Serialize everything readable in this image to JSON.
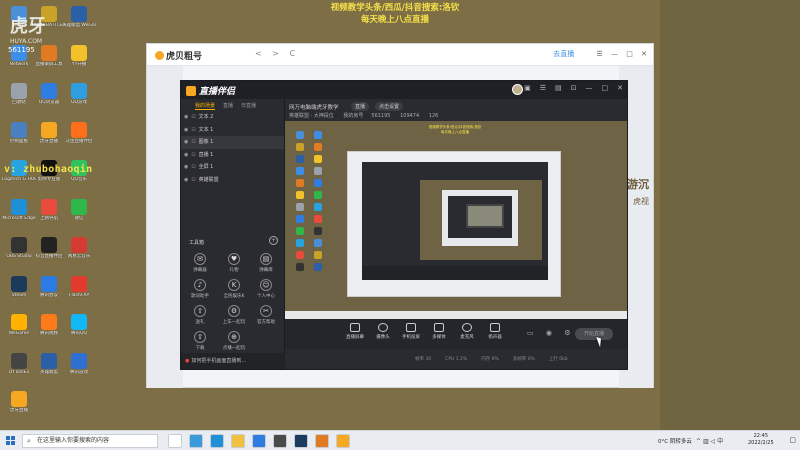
{
  "overlay": {
    "title_line1": "视频教学头条/西瓜/抖音搜索:洛钦",
    "title_line2": "每天晚上八点直播",
    "watermark_logo": "虎牙",
    "watermark_logo_sub": "HUYA.COM",
    "watermark_num": "561195",
    "wechat": "v: zhubohaoqin"
  },
  "desktop_icons": [
    {
      "label": "此电脑",
      "color": "#4a90d9"
    },
    {
      "label": "PUBG BATTLEGR...",
      "color": "#c9a227"
    },
    {
      "label": "英雄联盟 WeGame版",
      "color": "#2b5fa8"
    },
    {
      "label": "Network",
      "color": "#3c8ee6"
    },
    {
      "label": "直播录屏工具",
      "color": "#e07b24"
    },
    {
      "label": "YY开播",
      "color": "#f2c22a"
    },
    {
      "label": "回收站",
      "color": "#9aa3ad"
    },
    {
      "label": "QQ浏览器",
      "color": "#2f7de1"
    },
    {
      "label": "QQ游戏",
      "color": "#2f9ee1"
    },
    {
      "label": "控制面板",
      "color": "#4a7fc1"
    },
    {
      "label": "虎牙直播",
      "color": "#f7a823"
    },
    {
      "label": "斗鱼直播伴侣",
      "color": "#ff6e1a"
    },
    {
      "label": "Logitech G HUB",
      "color": "#27a3e0"
    },
    {
      "label": "剪映专业版",
      "color": "#111111"
    },
    {
      "label": "QQ音乐",
      "color": "#30c25e"
    },
    {
      "label": "Microsoft Edge",
      "color": "#1f8fd6"
    },
    {
      "label": "上网导航",
      "color": "#e84a3b"
    },
    {
      "label": "微信",
      "color": "#2fb84a"
    },
    {
      "label": "OBS Studio",
      "color": "#333333"
    },
    {
      "label": "抖音直播伴侣",
      "color": "#222222"
    },
    {
      "label": "网易云音乐",
      "color": "#d43c33"
    },
    {
      "label": "Steam",
      "color": "#1b3a5c"
    },
    {
      "label": "腾讯会议",
      "color": "#2c7be5"
    },
    {
      "label": "FlashFXP",
      "color": "#e23b2e"
    },
    {
      "label": "WeGame",
      "color": "#ffb300"
    },
    {
      "label": "腾讯视频",
      "color": "#ff7a1a"
    },
    {
      "label": "腾讯QQ",
      "color": "#12b7f5"
    },
    {
      "label": "DYToolEx",
      "color": "#444444"
    },
    {
      "label": "英雄联盟",
      "color": "#2b5fa8"
    },
    {
      "label": "腾讯游戏",
      "color": "#2f6fd1"
    },
    {
      "label": "虎牙直播",
      "color": "#f7a823"
    }
  ],
  "browser": {
    "logo": "虎贝粗号",
    "nav_back": "<",
    "nav_forward": ">",
    "nav_refresh": "C",
    "link_text": "去直播",
    "right_side_big": "游沉",
    "right_side_small": "虎视"
  },
  "app": {
    "logo": "直播伴侣",
    "win_buttons": [
      "▣",
      "☰",
      "▤",
      "⊡",
      "—",
      "□",
      "✕"
    ],
    "side_tabs": [
      "我的场景",
      "直播",
      "日直播"
    ],
    "scenes": [
      {
        "label": "文本 2",
        "selected": false
      },
      {
        "label": "文本 1",
        "selected": false
      },
      {
        "label": "图像 1",
        "selected": true
      },
      {
        "label": "直播 1",
        "selected": false
      },
      {
        "label": "全屏 1",
        "selected": false
      },
      {
        "label": "英雄联盟",
        "selected": false
      }
    ],
    "tools_label": "工具箱",
    "tools": [
      {
        "label": "弹幕器",
        "icon": "✉"
      },
      {
        "label": "礼物",
        "icon": "♥"
      },
      {
        "label": "弹幕库",
        "icon": "▤"
      },
      {
        "label": "歌词助手",
        "icon": "♪"
      },
      {
        "label": "全民娱乐K",
        "icon": "K"
      },
      {
        "label": "个人中心",
        "icon": "☺"
      },
      {
        "label": "送礼",
        "icon": "⇧"
      },
      {
        "label": "上车一起玩",
        "icon": "⚙"
      },
      {
        "label": "官方帮助",
        "icon": "✂"
      },
      {
        "label": "下载",
        "icon": "⇧"
      },
      {
        "label": "点播一起玩",
        "icon": "⊕"
      }
    ],
    "bottom_warning": "如何把手机画面直播到…",
    "room_title": "网万电脑端虎牙教学",
    "room_pill1": "直播",
    "room_pill2": "点击设置",
    "room_game": "英雄联盟 · 大神段位",
    "room_id_label": "我的房号",
    "room_id": "561195",
    "room_stat1": "109474",
    "room_stat2": "126",
    "preview_title_line1": "视频教学头条/西瓜/抖音搜索:洛钦",
    "preview_title_line2": "每天晚上八点直播",
    "controls": [
      {
        "label": "直播屏幕",
        "round": false
      },
      {
        "label": "摄像头",
        "round": true
      },
      {
        "label": "手机投屏",
        "round": false
      },
      {
        "label": "多媒体",
        "round": false
      },
      {
        "label": "麦克风",
        "round": true
      },
      {
        "label": "扬声器",
        "round": false
      }
    ],
    "start_button": "开始直播",
    "status_items": [
      "帧率 30",
      "CPU 1.2%",
      "内存 9%",
      "丢帧率 0%",
      "上行 0kb"
    ]
  },
  "taskbar": {
    "search_placeholder": "在这里输入你要搜索的内容",
    "weather": "0°C 阴转多云",
    "time": "22:45",
    "date": "2022/2/25",
    "apps": [
      "#ffffff",
      "#3a9bdc",
      "#1f8fd6",
      "#f0c040",
      "#2f7de1",
      "#4a4a4a",
      "#1b3a5c",
      "#e07b24",
      "#f7a823"
    ]
  }
}
